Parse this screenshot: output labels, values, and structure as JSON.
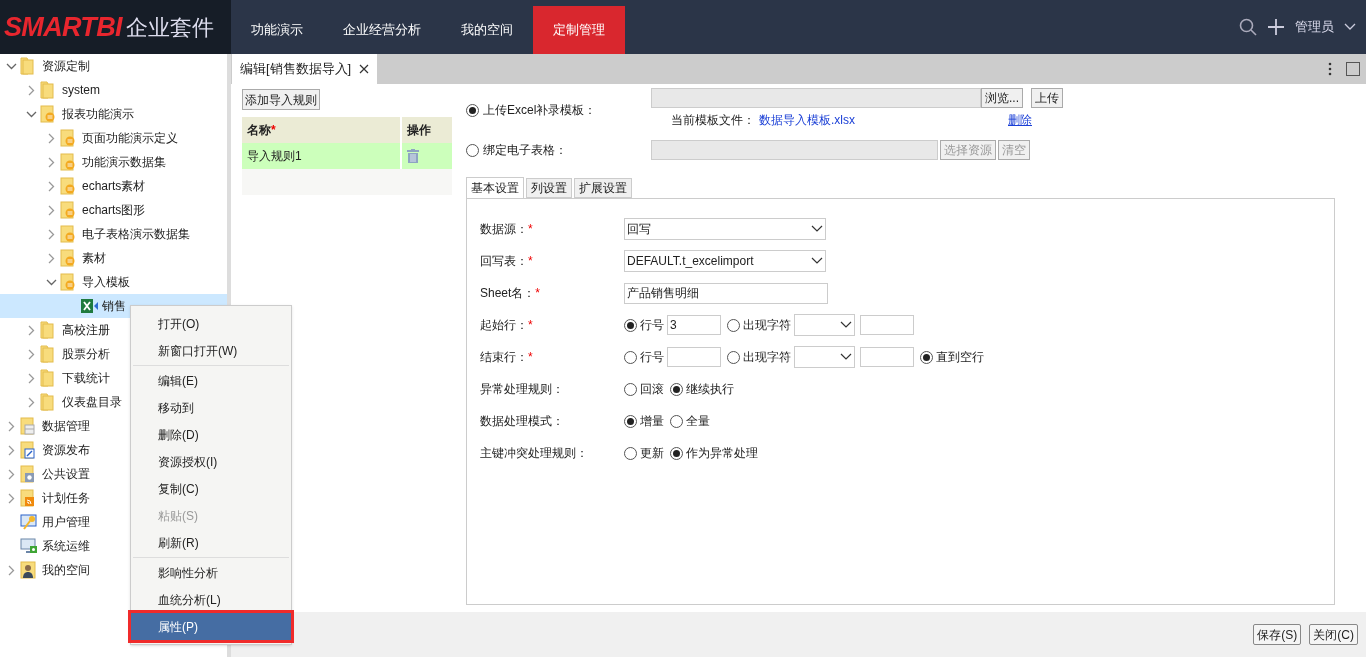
{
  "header": {
    "brand": "SMARTBI",
    "suffix": "企业套件",
    "user": "管理员"
  },
  "nav": [
    {
      "label": "功能演示",
      "selected": false
    },
    {
      "label": "企业经营分析",
      "selected": false
    },
    {
      "label": "我的空间",
      "selected": false
    },
    {
      "label": "定制管理",
      "selected": true
    }
  ],
  "tree": [
    {
      "label": "资源定制",
      "kind": "folder",
      "expandable": true,
      "expanded": true,
      "selected": false,
      "children": [
        {
          "label": "system",
          "kind": "folder",
          "expandable": true,
          "expanded": false,
          "selected": false
        },
        {
          "label": "报表功能演示",
          "kind": "report",
          "expandable": true,
          "expanded": true,
          "selected": false,
          "children": [
            {
              "label": "页面功能演示定义",
              "kind": "report",
              "expandable": true,
              "expanded": false,
              "selected": false
            },
            {
              "label": "功能演示数据集",
              "kind": "report",
              "expandable": true,
              "expanded": false,
              "selected": false
            },
            {
              "label": "echarts素材",
              "kind": "report",
              "expandable": true,
              "expanded": false,
              "selected": false
            },
            {
              "label": "echarts图形",
              "kind": "report",
              "expandable": true,
              "expanded": false,
              "selected": false
            },
            {
              "label": "电子表格演示数据集",
              "kind": "report",
              "expandable": true,
              "expanded": false,
              "selected": false
            },
            {
              "label": "素材",
              "kind": "report",
              "expandable": true,
              "expanded": false,
              "selected": false
            },
            {
              "label": "导入模板",
              "kind": "report",
              "expandable": true,
              "expanded": true,
              "selected": false,
              "children": [
                {
                  "label": "销售",
                  "kind": "excel",
                  "expandable": false,
                  "selected": true
                }
              ]
            }
          ]
        },
        {
          "label": "高校注册",
          "kind": "folder",
          "expandable": true,
          "expanded": false,
          "selected": false
        },
        {
          "label": "股票分析",
          "kind": "folder",
          "expandable": true,
          "expanded": false,
          "selected": false
        },
        {
          "label": "下载统计",
          "kind": "folder",
          "expandable": true,
          "expanded": false,
          "selected": false
        },
        {
          "label": "仪表盘目录",
          "kind": "folder",
          "expandable": true,
          "expanded": false,
          "selected": false
        }
      ]
    },
    {
      "label": "数据管理",
      "kind": "data",
      "expandable": true,
      "expanded": false,
      "selected": false
    },
    {
      "label": "资源发布",
      "kind": "publish",
      "expandable": true,
      "expanded": false,
      "selected": false
    },
    {
      "label": "公共设置",
      "kind": "settings",
      "expandable": true,
      "expanded": false,
      "selected": false
    },
    {
      "label": "计划任务",
      "kind": "task",
      "expandable": true,
      "expanded": false,
      "selected": false
    },
    {
      "label": "用户管理",
      "kind": "user",
      "expandable": false,
      "selected": false
    },
    {
      "label": "系统运维",
      "kind": "ops",
      "expandable": false,
      "selected": false
    },
    {
      "label": "我的空间",
      "kind": "person",
      "expandable": true,
      "expanded": false,
      "selected": false
    }
  ],
  "context_menu": [
    {
      "kind": "item",
      "label": "打开(O)",
      "disabled": false,
      "selected": false
    },
    {
      "kind": "item",
      "label": "新窗口打开(W)",
      "disabled": false,
      "selected": false
    },
    {
      "kind": "separator"
    },
    {
      "kind": "item",
      "label": "编辑(E)",
      "disabled": false,
      "selected": false
    },
    {
      "kind": "item",
      "label": "移动到",
      "disabled": false,
      "selected": false
    },
    {
      "kind": "item",
      "label": "删除(D)",
      "disabled": false,
      "selected": false
    },
    {
      "kind": "item",
      "label": "资源授权(I)",
      "disabled": false,
      "selected": false
    },
    {
      "kind": "item",
      "label": "复制(C)",
      "disabled": false,
      "selected": false
    },
    {
      "kind": "item",
      "label": "粘贴(S)",
      "disabled": true,
      "selected": false
    },
    {
      "kind": "item",
      "label": "刷新(R)",
      "disabled": false,
      "selected": false
    },
    {
      "kind": "separator"
    },
    {
      "kind": "item",
      "label": "影响性分析",
      "disabled": false,
      "selected": false
    },
    {
      "kind": "item",
      "label": "血统分析(L)",
      "disabled": false,
      "selected": false
    },
    {
      "kind": "item",
      "label": "属性(P)",
      "disabled": false,
      "selected": true
    }
  ],
  "editor": {
    "tab_title": "编辑[销售数据导入]",
    "add_button": "添加导入规则",
    "rules_table": {
      "columns": [
        {
          "label": "名称",
          "required_mark": "*"
        },
        {
          "label": "操作"
        }
      ],
      "rows": [
        {
          "name": "导入规则1"
        }
      ]
    },
    "upload": {
      "label": "上传Excel补录模板：",
      "selected": true,
      "browse_button": "浏览...",
      "upload_button": "上传",
      "current_file_label": "当前模板文件：",
      "current_file": "数据导入模板.xlsx",
      "delete_link": "删除"
    },
    "bind": {
      "label": "绑定电子表格：",
      "selected": false,
      "select_button": "选择资源",
      "clear_button": "清空",
      "disabled": true
    },
    "settings_tabs": [
      {
        "label": "基本设置",
        "selected": true
      },
      {
        "label": "列设置",
        "selected": false
      },
      {
        "label": "扩展设置",
        "selected": false
      }
    ],
    "form": [
      {
        "label": "数据源：",
        "required_mark": "*",
        "kind": "select",
        "value": "回写"
      },
      {
        "label": "回写表：",
        "required_mark": "*",
        "kind": "select",
        "value": "DEFAULT.t_excelimport"
      },
      {
        "label": "Sheet名：",
        "required_mark": "*",
        "kind": "text",
        "value": "产品销售明细"
      },
      {
        "label": "起始行：",
        "required_mark": "*",
        "kind": "radios",
        "options": [
          {
            "label": "行号",
            "selected": true,
            "kind": "number",
            "value": "3"
          },
          {
            "label": "出现字符",
            "selected": false,
            "kind": "char"
          }
        ]
      },
      {
        "label": "结束行：",
        "required_mark": "*",
        "kind": "radios",
        "options": [
          {
            "label": "行号",
            "selected": false,
            "kind": "number"
          },
          {
            "label": "出现字符",
            "selected": false,
            "kind": "char"
          },
          {
            "label": "直到空行",
            "selected": true,
            "kind": "plain"
          }
        ]
      },
      {
        "label": "异常处理规则：",
        "kind": "radios",
        "options": [
          {
            "label": "回滚",
            "selected": false,
            "kind": "plain"
          },
          {
            "label": "继续执行",
            "selected": true,
            "kind": "plain"
          }
        ]
      },
      {
        "label": "数据处理模式：",
        "kind": "radios",
        "options": [
          {
            "label": "增量",
            "selected": true,
            "kind": "plain"
          },
          {
            "label": "全量",
            "selected": false,
            "kind": "plain"
          }
        ]
      },
      {
        "label": "主键冲突处理规则：",
        "kind": "radios",
        "options": [
          {
            "label": "更新",
            "selected": false,
            "kind": "plain"
          },
          {
            "label": "作为异常处理",
            "selected": true,
            "kind": "plain"
          }
        ]
      }
    ]
  },
  "footer_buttons": [
    "保存(S)",
    "关闭(C)"
  ]
}
